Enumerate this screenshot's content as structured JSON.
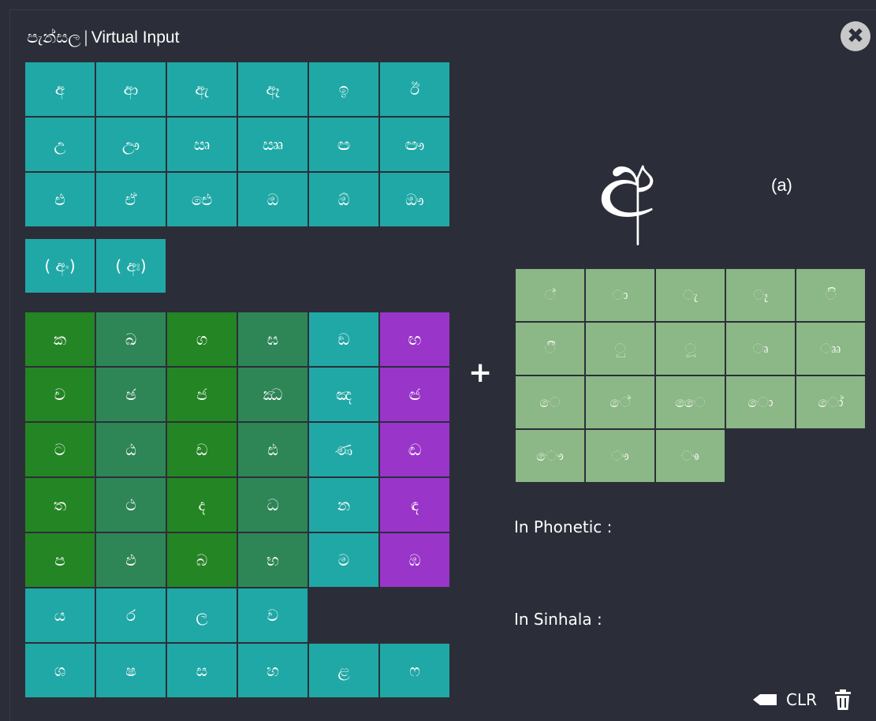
{
  "window": {
    "title_sinhala": "පැන්සල",
    "title_separator": "|",
    "title_text": "Virtual Input",
    "close_glyph": "✖"
  },
  "vowels": [
    "අ",
    "ආ",
    "ඇ",
    "ඈ",
    "ඉ",
    "ඊ",
    "උ",
    "ඌ",
    "ඍ",
    "ඎ",
    "ඏ",
    "ඐ",
    "එ",
    "ඒ",
    "ඓ",
    "ඔ",
    "ඕ",
    "ඖ"
  ],
  "modifiers": [
    "( අං)",
    "( අඃ)"
  ],
  "consonants": [
    {
      "char": "ක",
      "color": "dgreen"
    },
    {
      "char": "ඛ",
      "color": "mgreen"
    },
    {
      "char": "ග",
      "color": "dgreen"
    },
    {
      "char": "ඝ",
      "color": "mgreen"
    },
    {
      "char": "ඞ",
      "color": "teal"
    },
    {
      "char": "ඟ",
      "color": "purple"
    },
    {
      "char": "ච",
      "color": "dgreen"
    },
    {
      "char": "ඡ",
      "color": "mgreen"
    },
    {
      "char": "ජ",
      "color": "dgreen"
    },
    {
      "char": "ඣ",
      "color": "mgreen"
    },
    {
      "char": "ඤ",
      "color": "teal"
    },
    {
      "char": "ඦ",
      "color": "purple"
    },
    {
      "char": "ට",
      "color": "dgreen"
    },
    {
      "char": "ඨ",
      "color": "mgreen"
    },
    {
      "char": "ඩ",
      "color": "dgreen"
    },
    {
      "char": "ඪ",
      "color": "mgreen"
    },
    {
      "char": "ණ",
      "color": "teal"
    },
    {
      "char": "ඬ",
      "color": "purple"
    },
    {
      "char": "ත",
      "color": "dgreen"
    },
    {
      "char": "ථ",
      "color": "mgreen"
    },
    {
      "char": "ද",
      "color": "dgreen"
    },
    {
      "char": "ධ",
      "color": "mgreen"
    },
    {
      "char": "න",
      "color": "teal"
    },
    {
      "char": "ඳ",
      "color": "purple"
    },
    {
      "char": "ප",
      "color": "dgreen"
    },
    {
      "char": "ඵ",
      "color": "mgreen"
    },
    {
      "char": "බ",
      "color": "dgreen"
    },
    {
      "char": "භ",
      "color": "mgreen"
    },
    {
      "char": "ම",
      "color": "teal"
    },
    {
      "char": "ඹ",
      "color": "purple"
    },
    {
      "char": "ය",
      "color": "teal"
    },
    {
      "char": "ර",
      "color": "teal"
    },
    {
      "char": "ල",
      "color": "teal"
    },
    {
      "char": "ව",
      "color": "teal"
    },
    {
      "char": "",
      "color": "none"
    },
    {
      "char": "",
      "color": "none"
    },
    {
      "char": "ශ",
      "color": "teal"
    },
    {
      "char": "ෂ",
      "color": "teal"
    },
    {
      "char": "ස",
      "color": "teal"
    },
    {
      "char": "හ",
      "color": "teal"
    },
    {
      "char": "ළ",
      "color": "teal"
    },
    {
      "char": "ෆ",
      "color": "teal"
    }
  ],
  "plus_sign": "+",
  "diacritics": [
    "්",
    "ා",
    "ැ",
    "ෑ",
    "ි",
    "ී",
    "ු",
    "ූ",
    "ෘ",
    "ෲ",
    "ෙ",
    "ේ",
    "ෛ",
    "ො",
    "ෝ",
    "ෞ",
    "ෟ",
    "ෳ"
  ],
  "diacritic_base": "◌",
  "preview": {
    "letter": "අ",
    "phonetic": "(a)"
  },
  "labels": {
    "in_phonetic": "In Phonetic :",
    "in_sinhala": "In Sinhala :"
  },
  "footer": {
    "clr_label": "CLR",
    "eraser_icon": "eraser-icon",
    "trash_icon": "trash-icon"
  }
}
